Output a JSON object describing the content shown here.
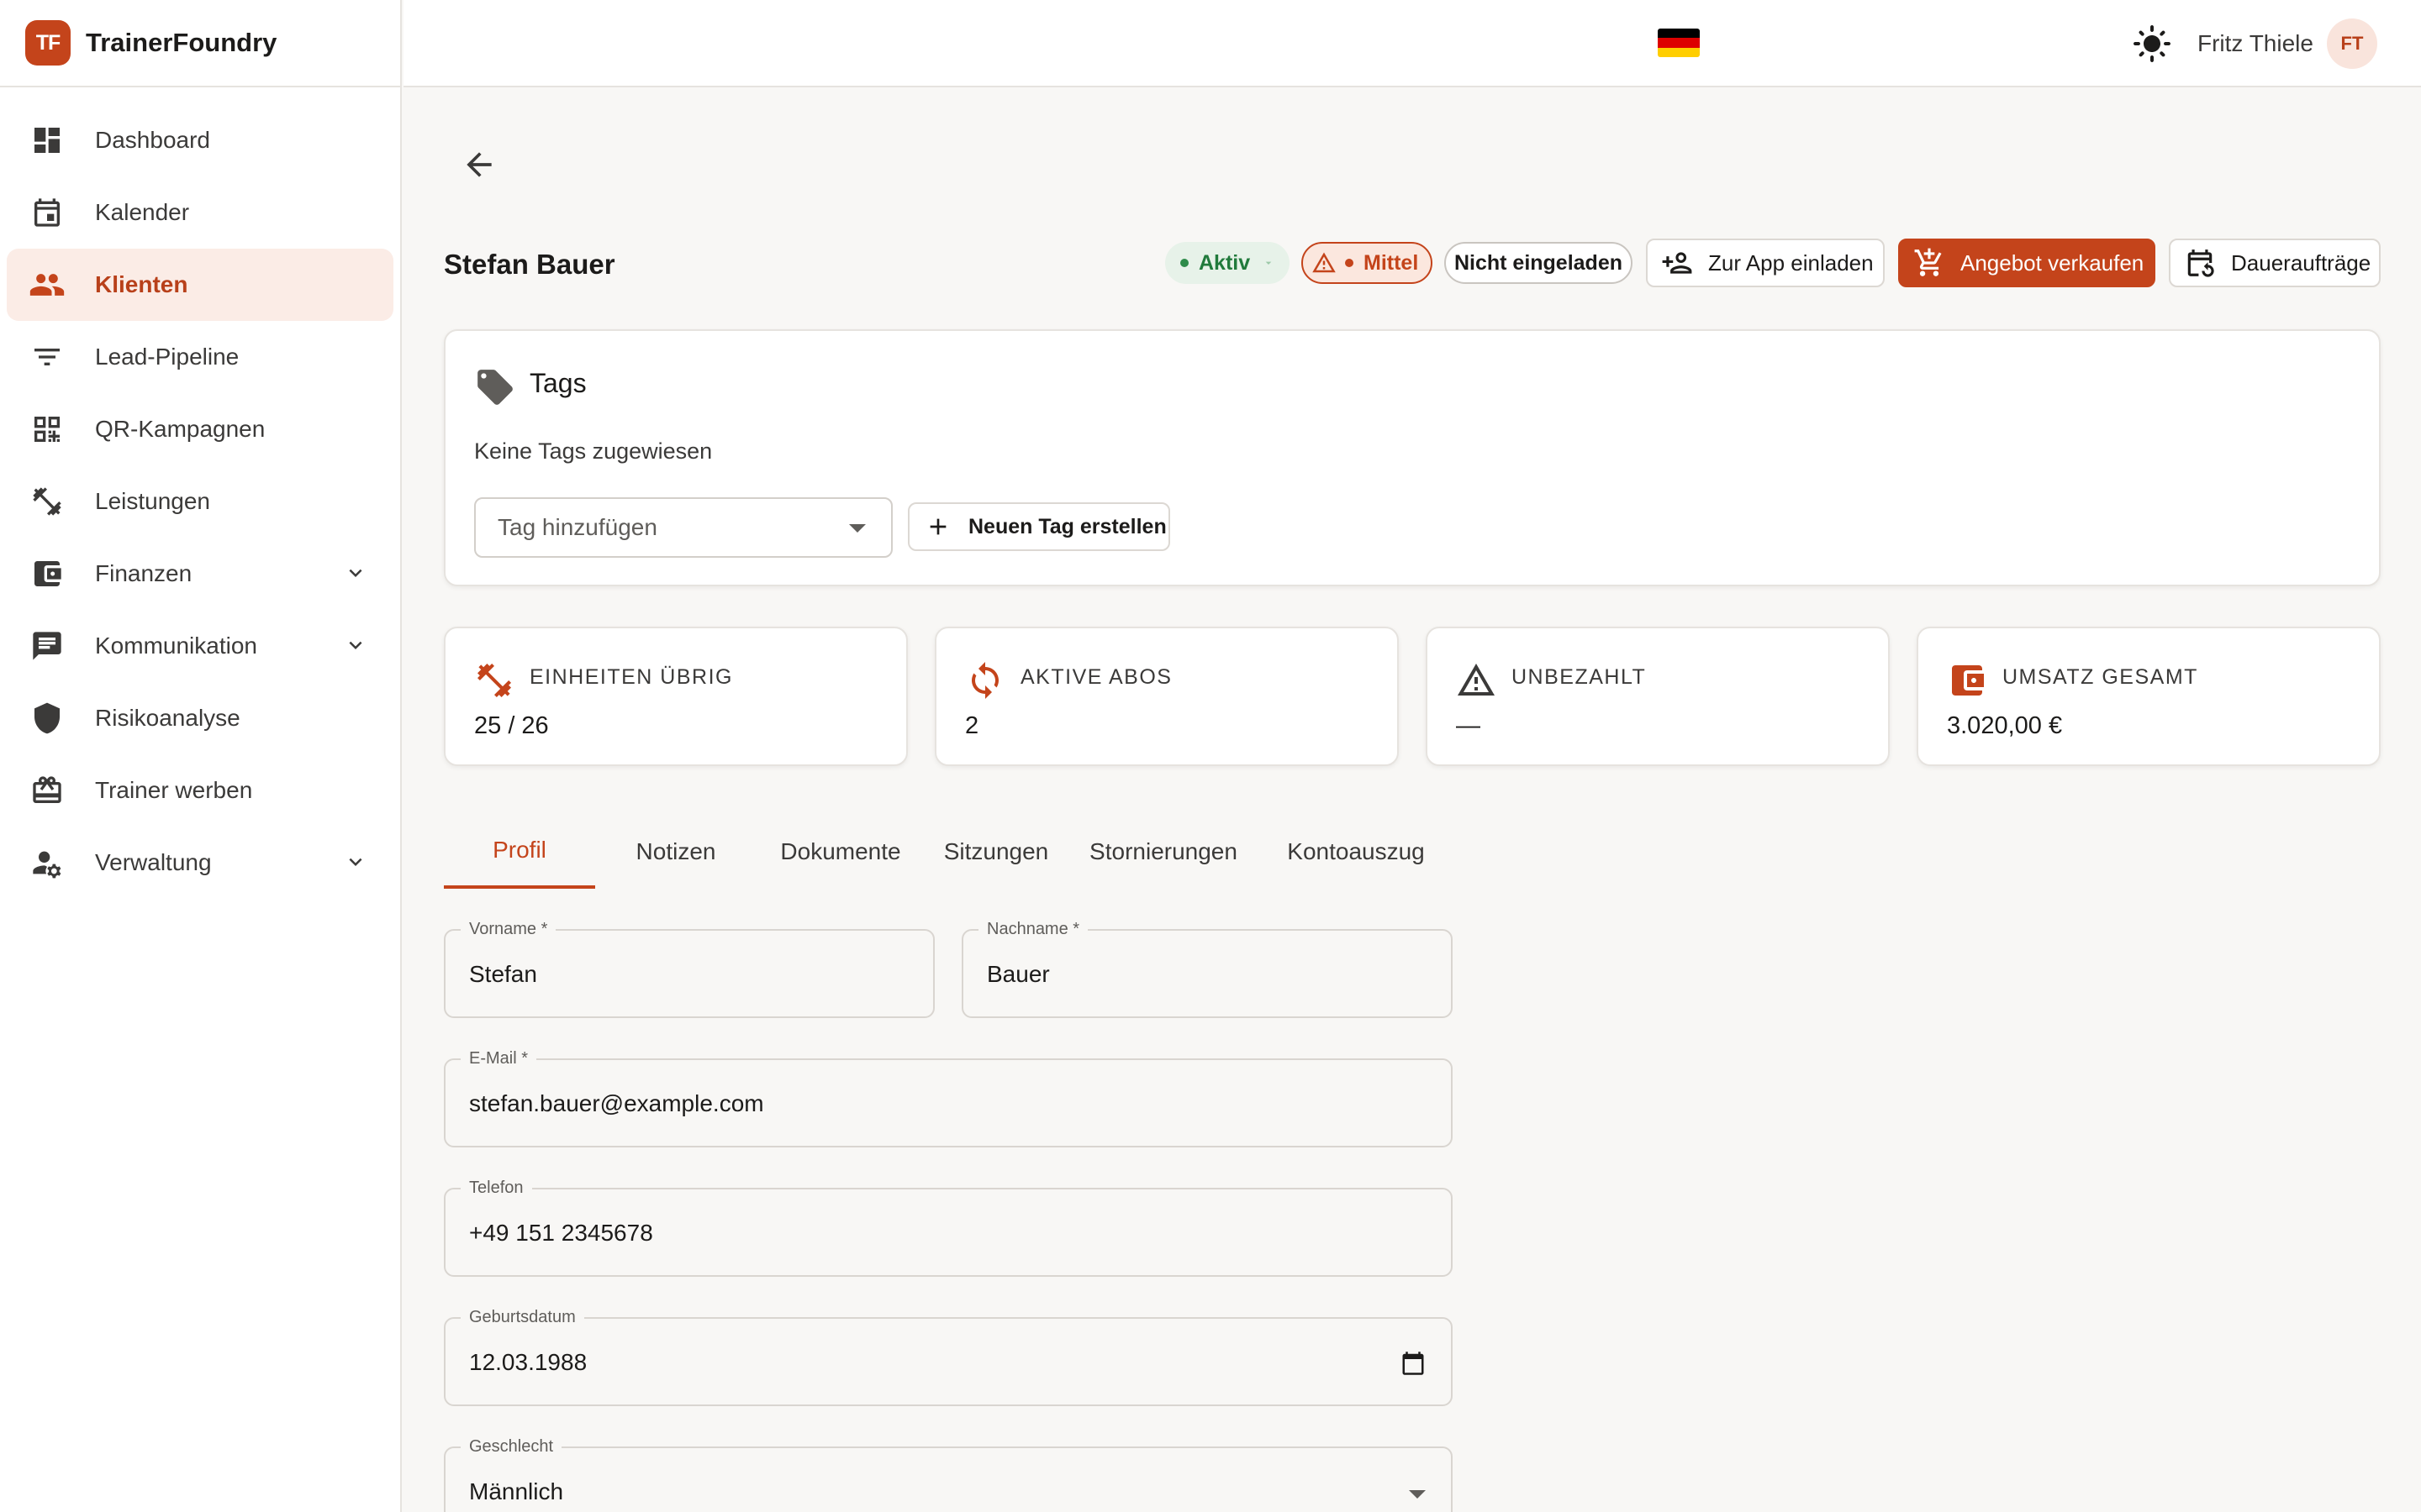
{
  "brand": {
    "logo_text": "TF",
    "name": "TrainerFoundry"
  },
  "sidebar": {
    "items": [
      {
        "label": "Dashboard",
        "icon": "dashboard-icon",
        "active": false
      },
      {
        "label": "Kalender",
        "icon": "calendar-icon",
        "active": false
      },
      {
        "label": "Klienten",
        "icon": "people-icon",
        "active": true
      },
      {
        "label": "Lead-Pipeline",
        "icon": "filter-icon",
        "active": false
      },
      {
        "label": "QR-Kampagnen",
        "icon": "qr-code-icon",
        "active": false
      },
      {
        "label": "Leistungen",
        "icon": "dumbbell-icon",
        "active": false
      },
      {
        "label": "Finanzen",
        "icon": "wallet-icon",
        "active": false,
        "expandable": true
      },
      {
        "label": "Kommunikation",
        "icon": "chat-icon",
        "active": false,
        "expandable": true
      },
      {
        "label": "Risikoanalyse",
        "icon": "shield-icon",
        "active": false
      },
      {
        "label": "Trainer werben",
        "icon": "gift-card-icon",
        "active": false
      },
      {
        "label": "Verwaltung",
        "icon": "user-settings-icon",
        "active": false,
        "expandable": true
      }
    ]
  },
  "topbar": {
    "language_flag": "german-flag-icon",
    "theme_icon": "sun-icon",
    "user_name": "Fritz Thiele",
    "user_initials": "FT"
  },
  "client": {
    "name": "Stefan Bauer",
    "status_label": "Aktiv",
    "risk_label": "Mittel",
    "invite_status": "Nicht eingeladen"
  },
  "actions": {
    "invite_app": "Zur App einladen",
    "sell_offer": "Angebot verkaufen",
    "standing_orders": "Daueraufträge"
  },
  "tags": {
    "title": "Tags",
    "empty_text": "Keine Tags zugewiesen",
    "select_placeholder": "Tag hinzufügen",
    "create_label": "Neuen Tag erstellen"
  },
  "kpis": [
    {
      "label": "EINHEITEN ÜBRIG",
      "value": "25 / 26",
      "icon": "dumbbell-icon"
    },
    {
      "label": "AKTIVE ABOS",
      "value": "2",
      "icon": "sync-icon"
    },
    {
      "label": "UNBEZAHLT",
      "value": "—",
      "icon": "warning-icon"
    },
    {
      "label": "UMSATZ GESAMT",
      "value": "3.020,00 €",
      "icon": "wallet-icon"
    }
  ],
  "tabs": [
    "Profil",
    "Notizen",
    "Dokumente",
    "Sitzungen",
    "Stornierungen",
    "Kontoauszug"
  ],
  "active_tab": "Profil",
  "form": {
    "firstname": {
      "label": "Vorname *",
      "value": "Stefan"
    },
    "lastname": {
      "label": "Nachname *",
      "value": "Bauer"
    },
    "email": {
      "label": "E-Mail *",
      "value": "stefan.bauer@example.com"
    },
    "phone": {
      "label": "Telefon",
      "value": "+49 151 2345678"
    },
    "birthdate": {
      "label": "Geburtsdatum",
      "value": "12.03.1988"
    },
    "gender": {
      "label": "Geschlecht",
      "value": "Männlich"
    }
  },
  "colors": {
    "accent": "#c4441b",
    "accent_light": "#fbece6",
    "success": "#217a3c",
    "background": "#f8f7f5"
  }
}
